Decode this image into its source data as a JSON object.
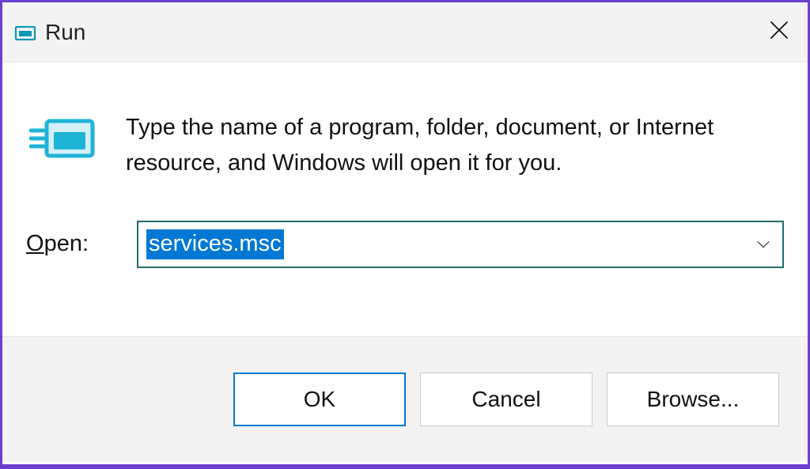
{
  "titleBar": {
    "title": "Run"
  },
  "content": {
    "description": "Type the name of a program, folder, document, or Internet resource, and Windows will open it for you.",
    "openLabelPrefix": "O",
    "openLabelRest": "pen:"
  },
  "combobox": {
    "value": "services.msc"
  },
  "buttons": {
    "ok": "OK",
    "cancel": "Cancel",
    "browse": "Browse..."
  }
}
